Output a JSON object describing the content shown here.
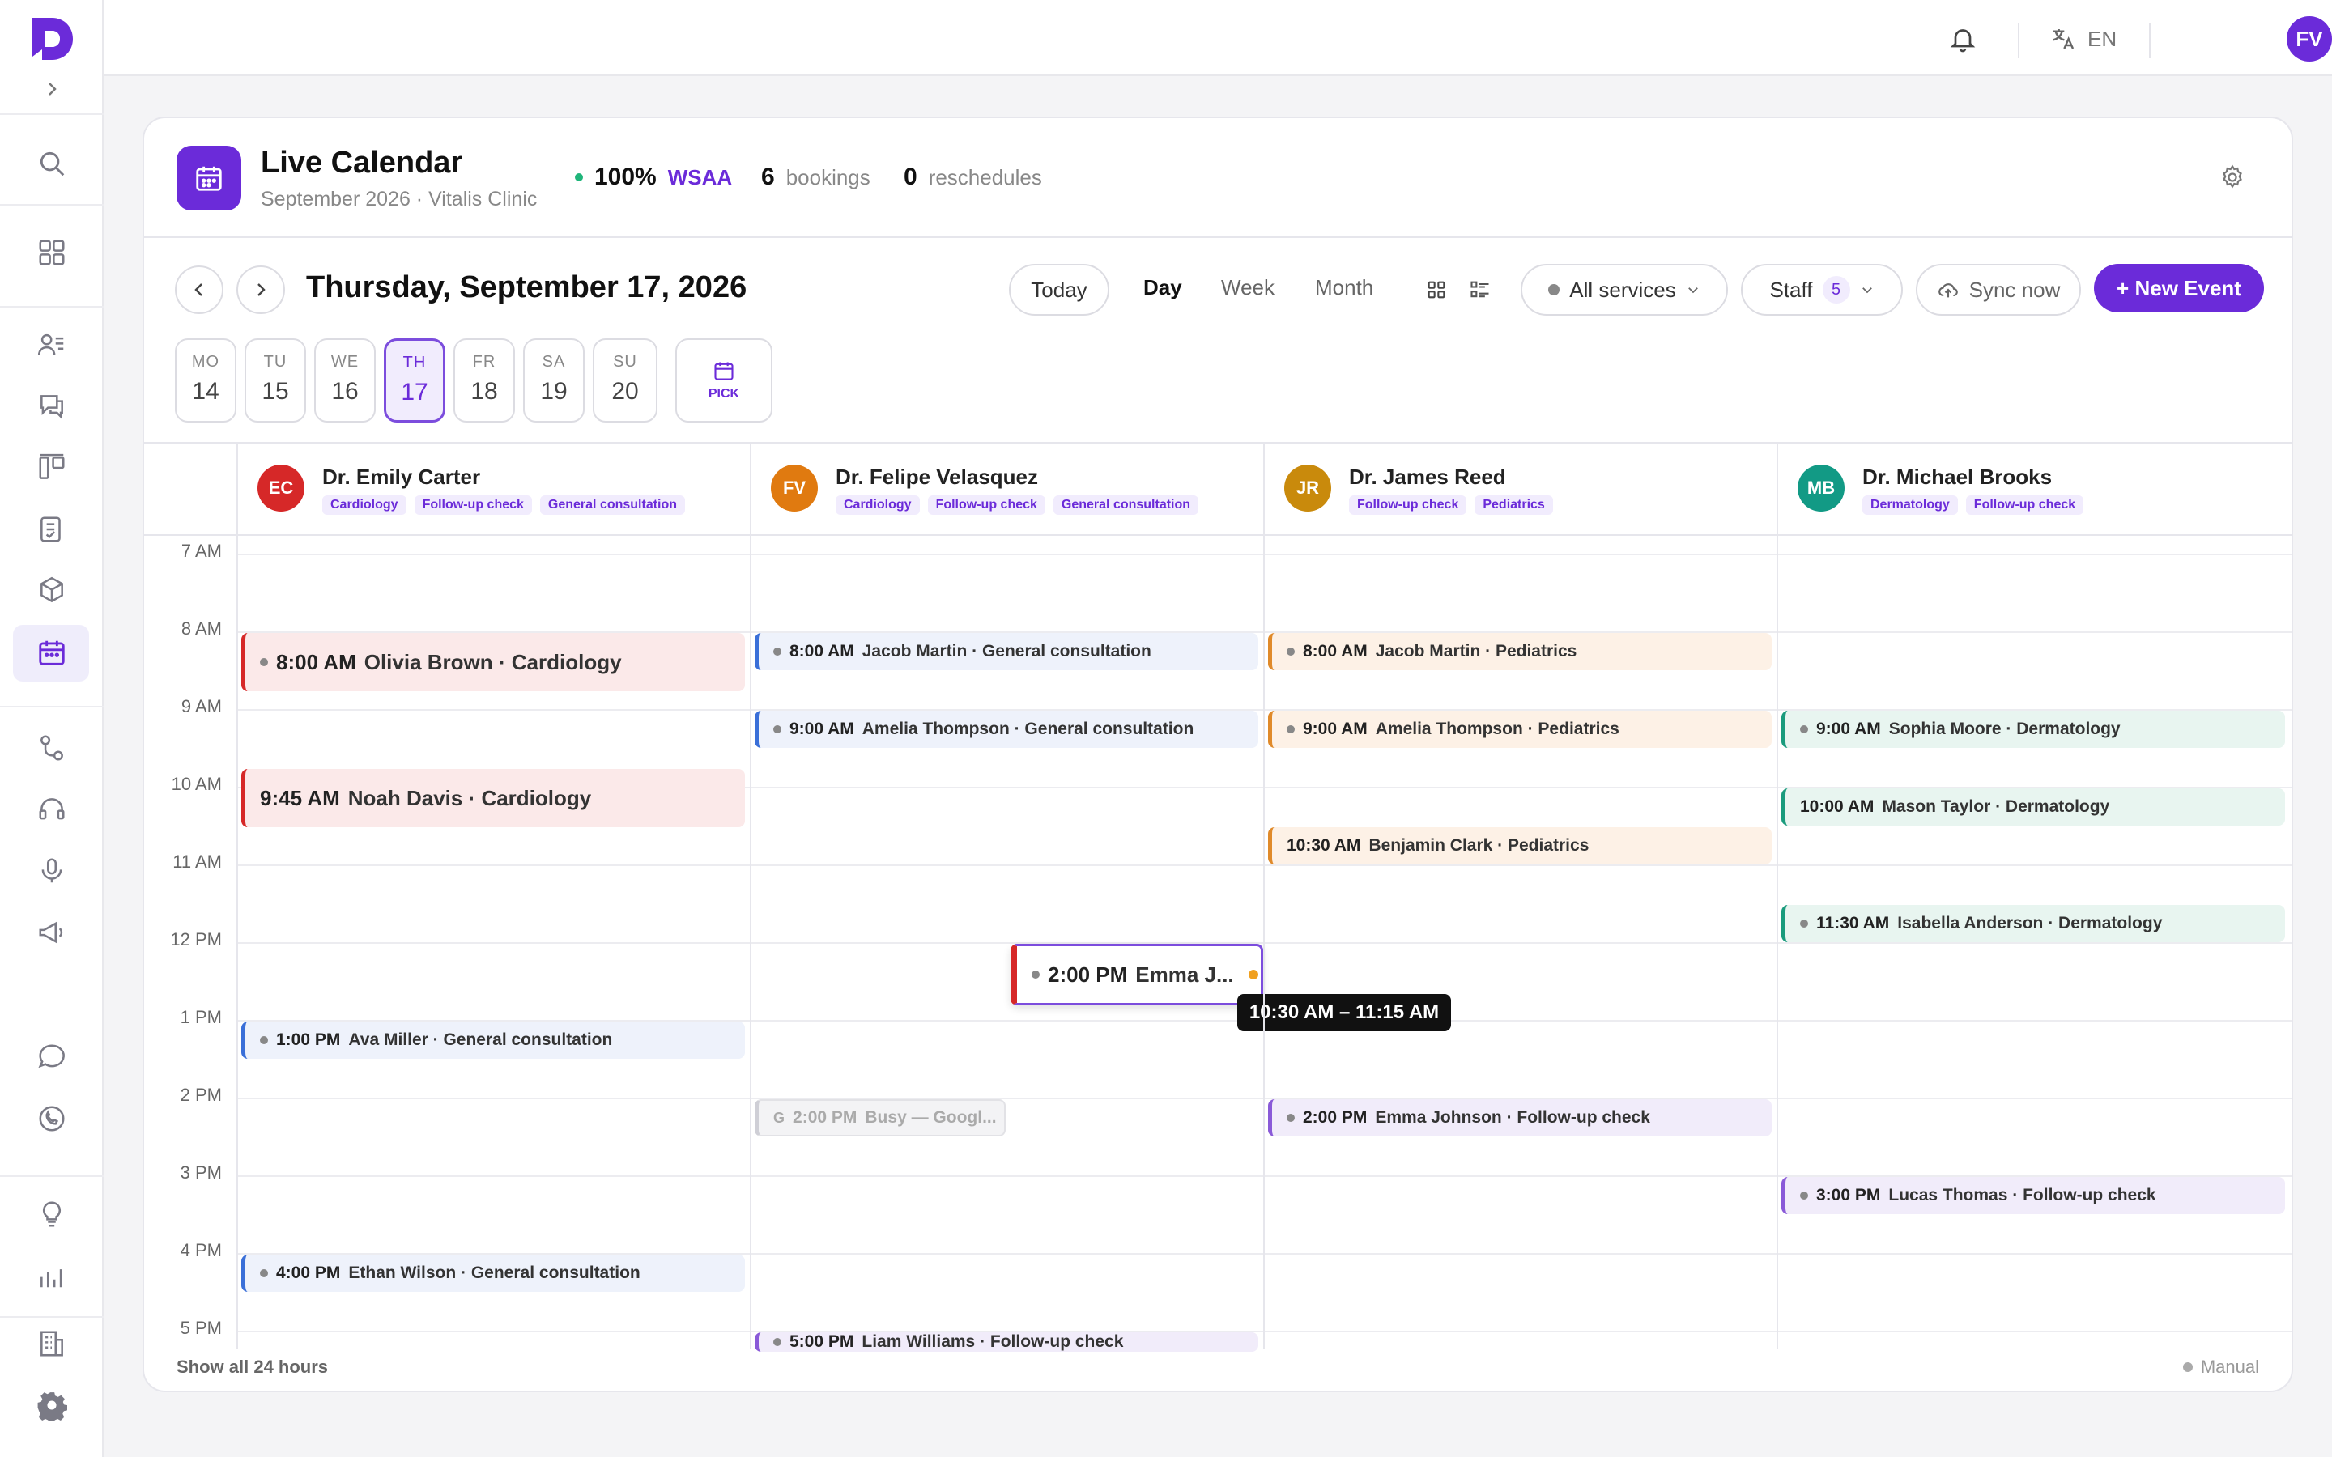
{
  "topbar": {
    "language": "EN",
    "user_initials": "FV"
  },
  "header": {
    "title": "Live Calendar",
    "subtitle": "September 2026 · Vitalis Clinic",
    "wsaa_value": "100%",
    "wsaa_label": "WSAA",
    "bookings_value": "6",
    "bookings_label": "bookings",
    "reschedules_value": "0",
    "reschedules_label": "reschedules"
  },
  "toolbar": {
    "date_title": "Thursday, September 17, 2026",
    "today": "Today",
    "views": [
      "Day",
      "Week",
      "Month"
    ],
    "active_view": "Day",
    "services": "All services",
    "staff_label": "Staff",
    "staff_count": "5",
    "sync": "Sync now",
    "new_event": "+ New Event"
  },
  "days": [
    {
      "label": "MO",
      "num": "14"
    },
    {
      "label": "TU",
      "num": "15"
    },
    {
      "label": "WE",
      "num": "16"
    },
    {
      "label": "TH",
      "num": "17"
    },
    {
      "label": "FR",
      "num": "18"
    },
    {
      "label": "SA",
      "num": "19"
    },
    {
      "label": "SU",
      "num": "20"
    }
  ],
  "pick_label": "PICK",
  "staff": [
    {
      "initials": "EC",
      "name": "Dr. Emily Carter",
      "color": "#d62828",
      "tags": [
        "Cardiology",
        "Follow-up check",
        "General consultation"
      ]
    },
    {
      "initials": "FV",
      "name": "Dr. Felipe Velasquez",
      "color": "#e07a10",
      "tags": [
        "Cardiology",
        "Follow-up check",
        "General consultation"
      ]
    },
    {
      "initials": "JR",
      "name": "Dr. James Reed",
      "color": "#c98a0c",
      "tags": [
        "Follow-up check",
        "Pediatrics"
      ]
    },
    {
      "initials": "MB",
      "name": "Dr. Michael Brooks",
      "color": "#129a85",
      "tags": [
        "Dermatology",
        "Follow-up check"
      ]
    }
  ],
  "hours": [
    "7 AM",
    "8 AM",
    "9 AM",
    "10 AM",
    "11 AM",
    "12 PM",
    "1 PM",
    "2 PM",
    "3 PM",
    "4 PM",
    "5 PM"
  ],
  "events": [
    {
      "col": 0,
      "time": "8:00 AM",
      "title": "Olivia Brown · Cardiology",
      "kind": "red",
      "big": true
    },
    {
      "col": 0,
      "time": "9:45 AM",
      "title": "Noah Davis · Cardiology",
      "kind": "red",
      "big": true
    },
    {
      "col": 0,
      "time": "1:00 PM",
      "title": "Ava Miller · General consultation",
      "kind": "blue"
    },
    {
      "col": 0,
      "time": "4:00 PM",
      "title": "Ethan Wilson · General consultation",
      "kind": "blue"
    },
    {
      "col": 1,
      "time": "8:00 AM",
      "title": "Jacob Martin · General consultation",
      "kind": "blue"
    },
    {
      "col": 1,
      "time": "9:00 AM",
      "title": "Amelia Thompson · General consultation",
      "kind": "blue"
    },
    {
      "col": 1,
      "time": "2:00 PM",
      "title": "Busy — Googl...",
      "kind": "busy"
    },
    {
      "col": 1,
      "time": "5:00 PM",
      "title": "Liam Williams · Follow-up check",
      "kind": "purple"
    },
    {
      "col": 2,
      "time": "8:00 AM",
      "title": "Jacob Martin · Pediatrics",
      "kind": "orange"
    },
    {
      "col": 2,
      "time": "9:00 AM",
      "title": "Amelia Thompson · Pediatrics",
      "kind": "orange"
    },
    {
      "col": 2,
      "time": "10:30 AM",
      "title": "Benjamin Clark · Pediatrics",
      "kind": "orange"
    },
    {
      "col": 2,
      "time": "2:00 PM",
      "title": "Emma Johnson · Follow-up check",
      "kind": "purple"
    },
    {
      "col": 3,
      "time": "9:00 AM",
      "title": "Sophia Moore · Dermatology",
      "kind": "green"
    },
    {
      "col": 3,
      "time": "10:00 AM",
      "title": "Mason Taylor · Dermatology",
      "kind": "green"
    },
    {
      "col": 3,
      "time": "11:30 AM",
      "title": "Isabella Anderson · Dermatology",
      "kind": "green"
    },
    {
      "col": 3,
      "time": "3:00 PM",
      "title": "Lucas Thomas · Follow-up check",
      "kind": "purple"
    }
  ],
  "dragging": {
    "time": "2:00 PM",
    "title": "Emma J...",
    "tooltip": "10:30 AM – 11:15 AM"
  },
  "footer": {
    "show_all": "Show all 24 hours",
    "mode": "Manual"
  },
  "colors": {
    "accent": "#6b2bd9",
    "red": "#d62828",
    "blue": "#3a6fd8",
    "orange": "#e08a2a",
    "green": "#1a9b7d",
    "purple": "#8a5ad8"
  }
}
